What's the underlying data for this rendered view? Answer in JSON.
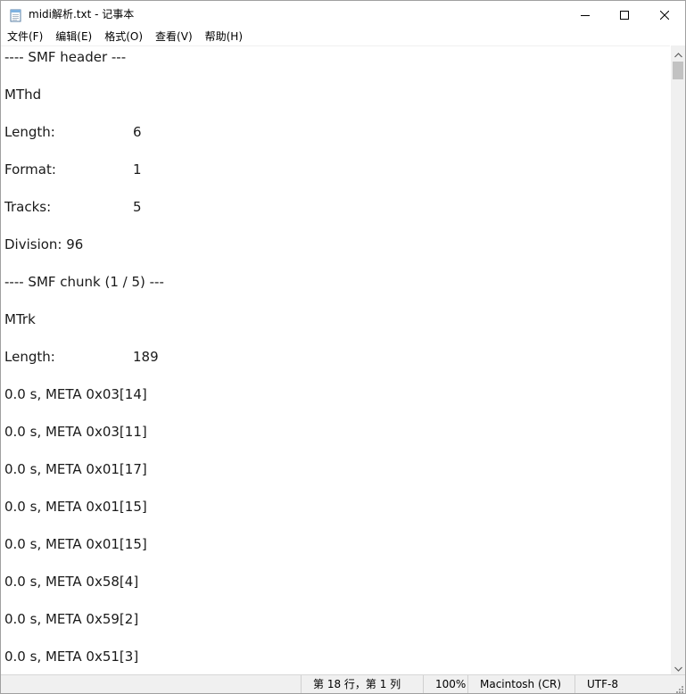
{
  "window": {
    "title": "midi解析.txt - 记事本",
    "icons": {
      "app": "notepad-icon",
      "minimize": "minimize-icon",
      "maximize": "maximize-icon",
      "close": "close-icon"
    }
  },
  "menu": {
    "items": [
      "文件(F)",
      "编辑(E)",
      "格式(O)",
      "查看(V)",
      "帮助(H)"
    ]
  },
  "editor": {
    "lines": [
      {
        "label": "---- SMF header ---",
        "value": ""
      },
      {
        "label": "MThd",
        "value": ""
      },
      {
        "label": "Length:",
        "value": "6"
      },
      {
        "label": "Format:",
        "value": "1"
      },
      {
        "label": "Tracks:",
        "value": "5"
      },
      {
        "label": "Division:  96",
        "value": ""
      },
      {
        "label": "---- SMF chunk (1 / 5) ---",
        "value": ""
      },
      {
        "label": "MTrk",
        "value": ""
      },
      {
        "label": "Length:",
        "value": "189"
      },
      {
        "label": "0.0 s, META 0x03[14]",
        "value": ""
      },
      {
        "label": "0.0 s, META 0x03[11]",
        "value": ""
      },
      {
        "label": "0.0 s, META 0x01[17]",
        "value": ""
      },
      {
        "label": "0.0 s, META 0x01[15]",
        "value": ""
      },
      {
        "label": "0.0 s, META 0x01[15]",
        "value": ""
      },
      {
        "label": "0.0 s, META 0x58[4]",
        "value": ""
      },
      {
        "label": "0.0 s, META 0x59[2]",
        "value": ""
      },
      {
        "label": "0.0 s, META 0x51[3]",
        "value": ""
      }
    ]
  },
  "scrollbar": {
    "up_icon": "scroll-up-arrow-icon",
    "down_icon": "scroll-down-arrow-icon"
  },
  "statusbar": {
    "position": "第 18 行，第 1 列",
    "zoom": "100%",
    "line_ending": "Macintosh (CR)",
    "encoding": "UTF-8"
  }
}
